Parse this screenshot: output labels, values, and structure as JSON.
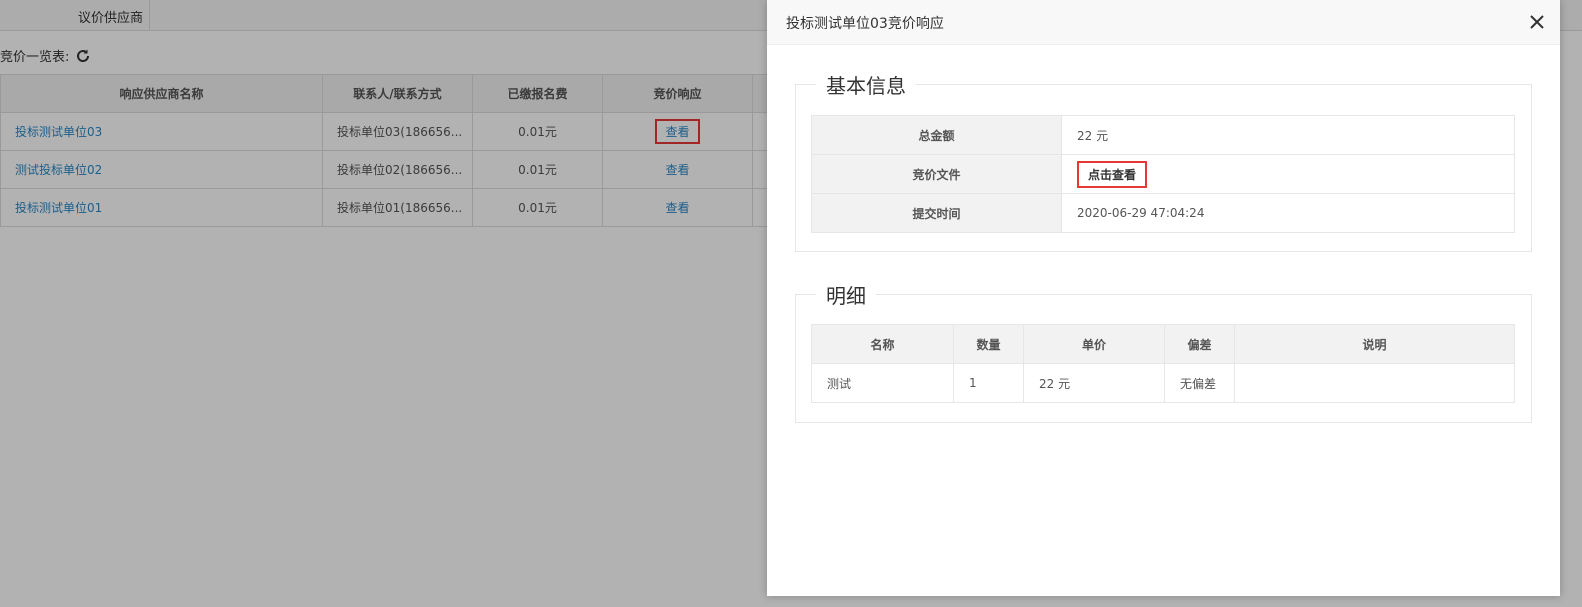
{
  "top_tab": {
    "label": "议价供应商"
  },
  "list": {
    "title": "竞价一览表:",
    "columns": [
      "响应供应商名称",
      "联系人/联系方式",
      "已缴报名费",
      "竞价响应"
    ],
    "rows": [
      {
        "name": "投标测试单位03",
        "contact": "投标单位03(186656...",
        "fee": "0.01元",
        "action": "查看"
      },
      {
        "name": "测试投标单位02",
        "contact": "投标单位02(186656...",
        "fee": "0.01元",
        "action": "查看"
      },
      {
        "name": "投标测试单位01",
        "contact": "投标单位01(186656...",
        "fee": "0.01元",
        "action": "查看"
      }
    ]
  },
  "dialog": {
    "title": "投标测试单位03竞价响应",
    "basic": {
      "legend": "基本信息",
      "rows": [
        {
          "label": "总金额",
          "value": "22 元"
        },
        {
          "label": "竞价文件",
          "value": "点击查看"
        },
        {
          "label": "提交时间",
          "value": "2020-06-29 47:04:24"
        }
      ]
    },
    "detail": {
      "legend": "明细",
      "columns": [
        "名称",
        "数量",
        "单价",
        "偏差",
        "说明"
      ],
      "rows": [
        {
          "name": "测试",
          "qty": "1",
          "price": "22 元",
          "deviation": "无偏差",
          "note": ""
        }
      ]
    }
  },
  "colors": {
    "link": "#2a88c8",
    "highlight": "#e53935",
    "overlay": "rgba(0,0,0,0.3)"
  },
  "icons": {
    "refresh": "refresh-icon",
    "close": "close-icon"
  }
}
